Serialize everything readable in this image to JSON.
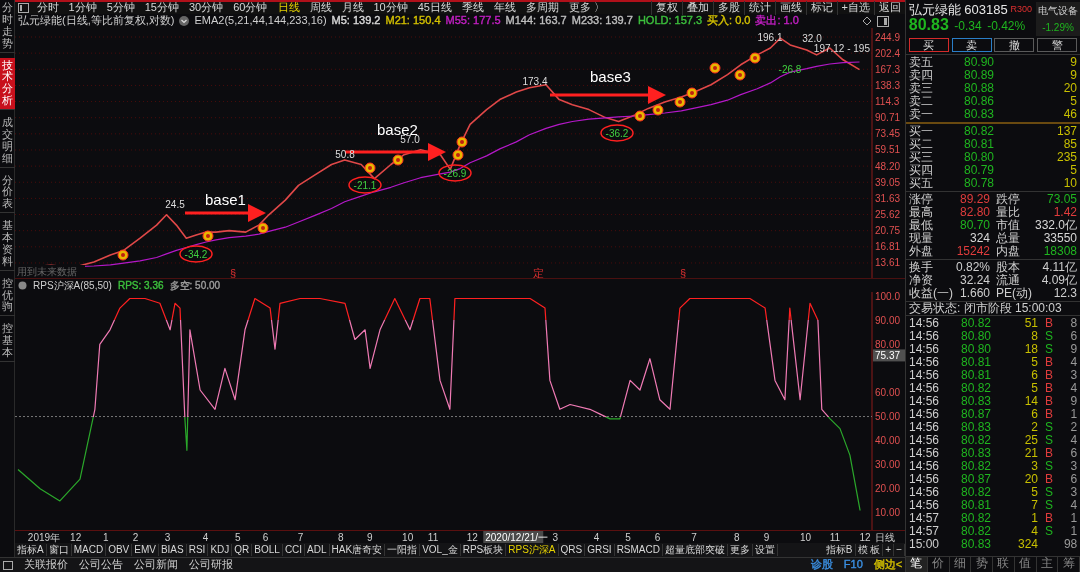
{
  "side_tabs": [
    {
      "label": "分时走势",
      "selected": false
    },
    {
      "label": "技术分析",
      "selected": true
    },
    {
      "label": "成交明细",
      "selected": false
    },
    {
      "label": "分价表",
      "selected": false
    },
    {
      "label": "基本资料",
      "selected": false
    },
    {
      "label": "控优驹",
      "selected": false
    },
    {
      "label": "控基本",
      "selected": false
    }
  ],
  "toolbar": {
    "periods": [
      {
        "label": "分时",
        "selected": false
      },
      {
        "label": "1分钟",
        "selected": false
      },
      {
        "label": "5分钟",
        "selected": false
      },
      {
        "label": "15分钟",
        "selected": false
      },
      {
        "label": "30分钟",
        "selected": false
      },
      {
        "label": "60分钟",
        "selected": false
      },
      {
        "label": "日线",
        "selected": true
      },
      {
        "label": "周线",
        "selected": false
      },
      {
        "label": "月线",
        "selected": false
      },
      {
        "label": "10分钟",
        "selected": false
      },
      {
        "label": "45日线",
        "selected": false
      },
      {
        "label": "季线",
        "selected": false
      },
      {
        "label": "年线",
        "selected": false
      },
      {
        "label": "多周期",
        "selected": false
      },
      {
        "label": "更多 〉",
        "selected": false
      }
    ],
    "actions": [
      "复权",
      "叠加",
      "多股",
      "统计",
      "画线",
      "标记",
      "+自选",
      "返回"
    ]
  },
  "info_bar": {
    "title": "弘元绿能(日线,等比前复权,对数)",
    "indicator": "EMA2(5,21,44,144,233,16)",
    "values": [
      {
        "text": "M5: 139.2",
        "color": "#d8d8d8"
      },
      {
        "text": "M21: 150.4",
        "color": "#d2bf00"
      },
      {
        "text": "M55: 177.5",
        "color": "#c21fc2"
      },
      {
        "text": "M144: 163.7",
        "color": "#bdbdbd"
      },
      {
        "text": "M233: 139.7",
        "color": "#bdbdbd"
      },
      {
        "text": "HOLD: 157.3",
        "color": "#3cbf3c"
      },
      {
        "text": "买入: 0.0",
        "color": "#d2bf00"
      },
      {
        "text": "卖出: 1.0",
        "color": "#c21fc2"
      }
    ]
  },
  "price_chart": {
    "note": "用到未来数据",
    "axis_labels": [
      "244.9",
      "202.4",
      "167.3",
      "138.3",
      "114.3",
      "90.71",
      "73.45",
      "59.51",
      "48.20",
      "39.05",
      "31.63",
      "25.62",
      "20.75",
      "16.81",
      "13.61"
    ],
    "event_marks": [
      "§",
      "定",
      "§"
    ],
    "overlays": [
      {
        "kind": "arrow"
      },
      {
        "kind": "note",
        "text": "base1"
      },
      {
        "kind": "arrow"
      },
      {
        "kind": "note",
        "text": "base2"
      },
      {
        "kind": "arrow"
      },
      {
        "kind": "note",
        "text": "base3"
      },
      {
        "kind": "circled",
        "text": "-34.2"
      },
      {
        "kind": "circled",
        "text": "-21.1"
      },
      {
        "kind": "circled",
        "text": "-26.9"
      },
      {
        "kind": "circled",
        "text": "-36.2"
      },
      {
        "kind": "label",
        "text": "24.5"
      },
      {
        "kind": "label",
        "text": "50.8"
      },
      {
        "kind": "label",
        "text": "57.0"
      },
      {
        "kind": "label",
        "text": "173.4"
      },
      {
        "kind": "label",
        "text": "196.1"
      },
      {
        "kind": "label",
        "text": "32.0"
      },
      {
        "kind": "label",
        "text": "197.12 - 195"
      },
      {
        "kind": "low",
        "text": "-26.8"
      },
      {
        "kind": "coin"
      },
      {
        "kind": "coin"
      },
      {
        "kind": "coin"
      },
      {
        "kind": "coin"
      },
      {
        "kind": "coin"
      },
      {
        "kind": "coin"
      },
      {
        "kind": "coin"
      },
      {
        "kind": "coin"
      },
      {
        "kind": "coin"
      },
      {
        "kind": "coin"
      },
      {
        "kind": "coin"
      },
      {
        "kind": "coin"
      },
      {
        "kind": "coin"
      },
      {
        "kind": "coin"
      }
    ]
  },
  "indicator_bar": {
    "title": "RPS沪深A(85,50)",
    "values": [
      {
        "text": "RPS: 3.36",
        "color": "#3cbf3c"
      },
      {
        "text": "多空: 50.00",
        "color": "#9a9a9a"
      }
    ]
  },
  "rps_chart": {
    "cursor_label": "2020/12/21/一",
    "period": "日线",
    "current_value": "75.37",
    "axis_labels": [
      "100.0",
      "90.00",
      "80.00",
      "60.00",
      "50.00",
      "40.00",
      "30.00",
      "20.00",
      "10.00"
    ],
    "x_axis_labels": [
      "2019年",
      "12",
      "1",
      "2",
      "3",
      "4",
      "5",
      "6",
      "7",
      "8",
      "9",
      "10",
      "11",
      "12",
      "3",
      "4",
      "5",
      "6",
      "7",
      "8",
      "9",
      "10",
      "11",
      "12"
    ]
  },
  "indicator_tabs": [
    {
      "label": "指标A",
      "selected": false
    },
    {
      "label": "窗口",
      "selected": false
    },
    {
      "label": "MACD",
      "selected": false
    },
    {
      "label": "OBV",
      "selected": false
    },
    {
      "label": "EMV",
      "selected": false
    },
    {
      "label": "BIAS",
      "selected": false
    },
    {
      "label": "RSI",
      "selected": false
    },
    {
      "label": "KDJ",
      "selected": false
    },
    {
      "label": "QR",
      "selected": false
    },
    {
      "label": "BOLL",
      "selected": false
    },
    {
      "label": "CCI",
      "selected": false
    },
    {
      "label": "ADL",
      "selected": false
    },
    {
      "label": "HAK唐奇安",
      "selected": false
    },
    {
      "label": "一阳指",
      "selected": false
    },
    {
      "label": "VOL_金",
      "selected": false
    },
    {
      "label": "RPS板块",
      "selected": false
    },
    {
      "label": "RPS沪深A",
      "selected": true
    },
    {
      "label": "QRS",
      "selected": false
    },
    {
      "label": "GRSI",
      "selected": false
    },
    {
      "label": "RSMACD",
      "selected": false
    },
    {
      "label": "超量底部突破",
      "selected": false
    },
    {
      "label": "更多",
      "selected": false
    },
    {
      "label": "设置",
      "selected": false
    }
  ],
  "indicator_tools": [
    "指标B",
    "模 板",
    "+",
    "−"
  ],
  "status_bar": {
    "links": [
      "关联报价",
      "公司公告",
      "公司新闻",
      "公司研报"
    ],
    "tools": [
      {
        "text": "诊股",
        "color": "#3a8ee0"
      },
      {
        "text": "F10",
        "color": "#3a8ee0"
      },
      {
        "text": "侧边<",
        "color": "#d2bf00"
      }
    ]
  },
  "quote": {
    "name": "弘元绿能",
    "code": "603185",
    "badge": "R300",
    "sector": "电气设备",
    "sector_change": "-1.29%",
    "price": "80.83",
    "change": "-0.34",
    "change_pct": "-0.42%"
  },
  "trade_buttons": [
    {
      "label": "买",
      "color": "#d42a2a"
    },
    {
      "label": "卖",
      "color": "#2a7ec8"
    },
    {
      "label": "撤",
      "color": "#5a5a5a"
    },
    {
      "label": "警",
      "color": "#5a5a5a"
    }
  ],
  "asks": [
    {
      "label": "卖五",
      "price": "80.90",
      "volume": "9"
    },
    {
      "label": "卖四",
      "price": "80.89",
      "volume": "9"
    },
    {
      "label": "卖三",
      "price": "80.88",
      "volume": "20"
    },
    {
      "label": "卖二",
      "price": "80.86",
      "volume": "5"
    },
    {
      "label": "卖一",
      "price": "80.83",
      "volume": "46"
    }
  ],
  "bids": [
    {
      "label": "买一",
      "price": "80.82",
      "volume": "137"
    },
    {
      "label": "买二",
      "price": "80.81",
      "volume": "85"
    },
    {
      "label": "买三",
      "price": "80.80",
      "volume": "235"
    },
    {
      "label": "买四",
      "price": "80.79",
      "volume": "5"
    },
    {
      "label": "买五",
      "price": "80.78",
      "volume": "10"
    }
  ],
  "stats": [
    {
      "label": "涨停",
      "value": "89.29",
      "color": "#e03c3c"
    },
    {
      "label": "跌停",
      "value": "73.05",
      "color": "#1fb51f"
    },
    {
      "label": "最高",
      "value": "82.80",
      "color": "#e03c3c"
    },
    {
      "label": "量比",
      "value": "1.42",
      "color": "#e03c3c"
    },
    {
      "label": "最低",
      "value": "80.70",
      "color": "#1fb51f"
    },
    {
      "label": "市值",
      "value": "332.0亿",
      "color": "#d8d8d8"
    },
    {
      "label": "现量",
      "value": "324",
      "color": "#d8d8d8"
    },
    {
      "label": "总量",
      "value": "33550",
      "color": "#d8d8d8"
    },
    {
      "label": "外盘",
      "value": "15242",
      "color": "#e03c3c"
    },
    {
      "label": "内盘",
      "value": "18308",
      "color": "#1fb51f"
    }
  ],
  "fundamentals": [
    {
      "label": "换手",
      "value": "0.82%"
    },
    {
      "label": "股本",
      "value": "4.11亿"
    },
    {
      "label": "净资",
      "value": "32.24"
    },
    {
      "label": "流通",
      "value": "4.09亿"
    },
    {
      "label": "收益(一)",
      "value": "1.660"
    },
    {
      "label": "PE(动)",
      "value": "12.3"
    }
  ],
  "trading_status": "交易状态: 闭市阶段 15:00:03",
  "trades": [
    {
      "time": "14:56",
      "price": "80.82",
      "volume": "51",
      "side": "B",
      "color": "#e03c3c",
      "count": "8"
    },
    {
      "time": "14:56",
      "price": "80.80",
      "volume": "8",
      "side": "S",
      "color": "#1fb51f",
      "count": "6"
    },
    {
      "time": "14:56",
      "price": "80.80",
      "volume": "18",
      "side": "S",
      "color": "#1fb51f",
      "count": "9"
    },
    {
      "time": "14:56",
      "price": "80.81",
      "volume": "5",
      "side": "B",
      "color": "#e03c3c",
      "count": "4"
    },
    {
      "time": "14:56",
      "price": "80.81",
      "volume": "6",
      "side": "B",
      "color": "#e03c3c",
      "count": "3"
    },
    {
      "time": "14:56",
      "price": "80.82",
      "volume": "5",
      "side": "B",
      "color": "#e03c3c",
      "count": "4"
    },
    {
      "time": "14:56",
      "price": "80.83",
      "volume": "14",
      "side": "B",
      "color": "#e03c3c",
      "count": "9"
    },
    {
      "time": "14:56",
      "price": "80.87",
      "volume": "6",
      "side": "B",
      "color": "#e03c3c",
      "count": "1"
    },
    {
      "time": "14:56",
      "price": "80.83",
      "volume": "2",
      "side": "S",
      "color": "#1fb51f",
      "count": "2"
    },
    {
      "time": "14:56",
      "price": "80.82",
      "volume": "25",
      "side": "S",
      "color": "#1fb51f",
      "count": "4"
    },
    {
      "time": "14:56",
      "price": "80.83",
      "volume": "21",
      "side": "B",
      "color": "#e03c3c",
      "count": "6"
    },
    {
      "time": "14:56",
      "price": "80.82",
      "volume": "3",
      "side": "S",
      "color": "#1fb51f",
      "count": "3"
    },
    {
      "time": "14:56",
      "price": "80.87",
      "volume": "20",
      "side": "B",
      "color": "#e03c3c",
      "count": "6"
    },
    {
      "time": "14:56",
      "price": "80.82",
      "volume": "5",
      "side": "S",
      "color": "#1fb51f",
      "count": "3"
    },
    {
      "time": "14:56",
      "price": "80.81",
      "volume": "7",
      "side": "S",
      "color": "#1fb51f",
      "count": "4"
    },
    {
      "time": "14:57",
      "price": "80.82",
      "volume": "1",
      "side": "B",
      "color": "#e03c3c",
      "count": "1"
    },
    {
      "time": "14:57",
      "price": "80.82",
      "volume": "4",
      "side": "S",
      "color": "#1fb51f",
      "count": "1"
    },
    {
      "time": "15:00",
      "price": "80.83",
      "volume": "324",
      "count": "98"
    }
  ],
  "panel_tabs": [
    {
      "label": "笔",
      "selected": true
    },
    {
      "label": "价",
      "selected": false
    },
    {
      "label": "细",
      "selected": false
    },
    {
      "label": "势",
      "selected": false
    },
    {
      "label": "联",
      "selected": false
    },
    {
      "label": "值",
      "selected": false
    },
    {
      "label": "主",
      "selected": false
    },
    {
      "label": "筹",
      "selected": false
    }
  ]
}
